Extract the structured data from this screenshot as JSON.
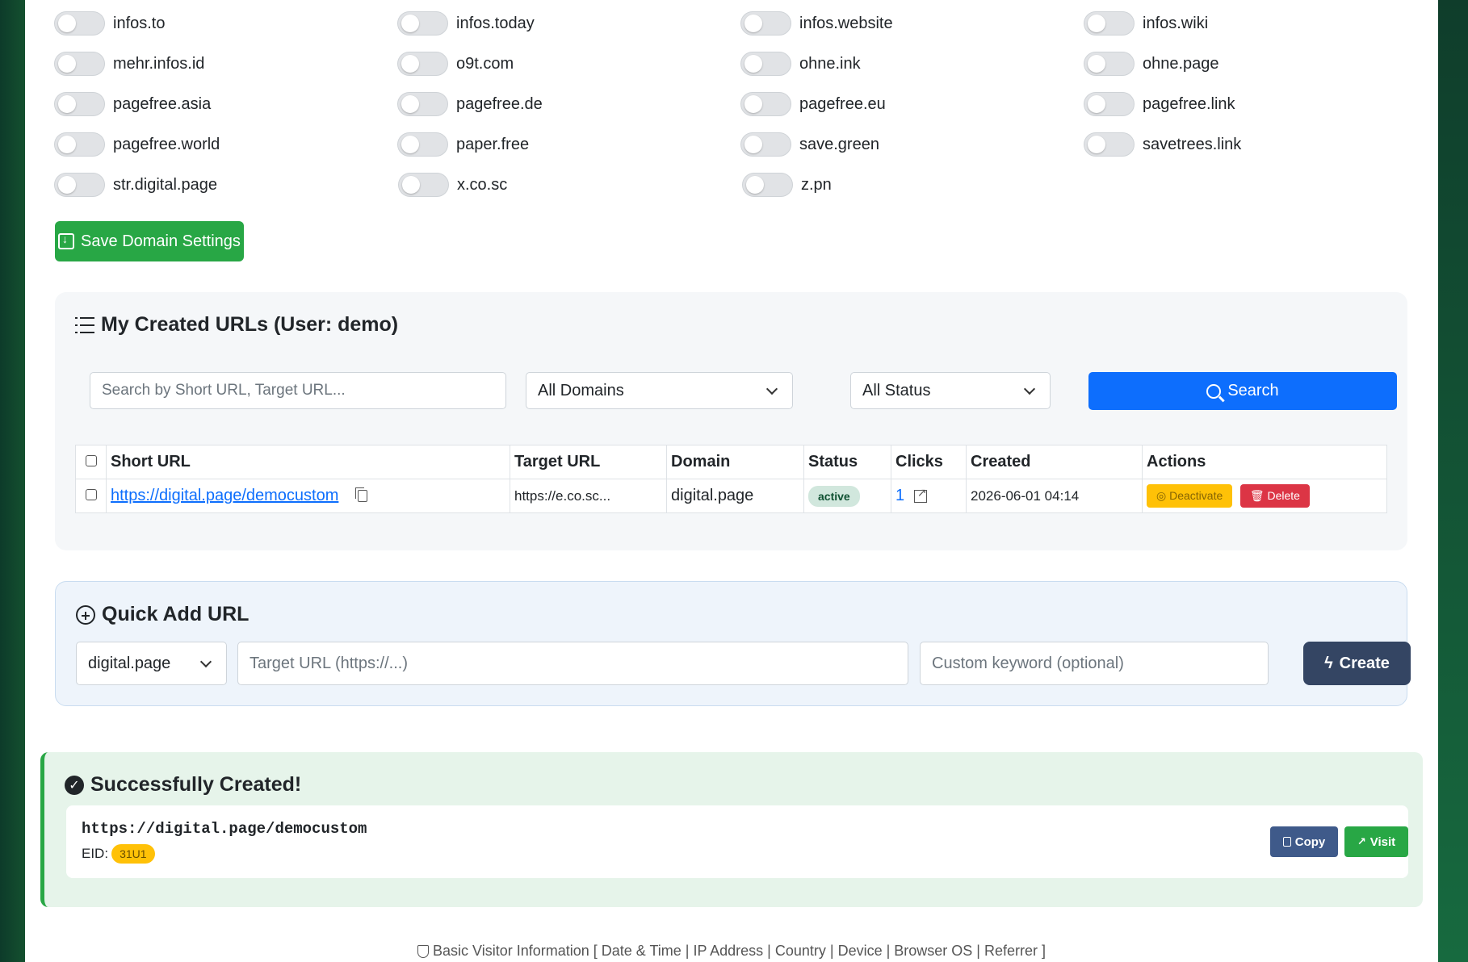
{
  "domains": [
    [
      "infos.to",
      "infos.today",
      "infos.website",
      "infos.wiki"
    ],
    [
      "mehr.infos.id",
      "o9t.com",
      "ohne.ink",
      "ohne.page"
    ],
    [
      "pagefree.asia",
      "pagefree.de",
      "pagefree.eu",
      "pagefree.link"
    ],
    [
      "pagefree.world",
      "paper.free",
      "save.green",
      "savetrees.link"
    ],
    [
      "str.digital.page",
      "x.co.sc",
      "z.pn",
      ""
    ]
  ],
  "save_label": "Save Domain Settings",
  "urls_card": {
    "title": "My Created URLs (User: demo)",
    "search_placeholder": "Search by Short URL, Target URL...",
    "domain_filter": "All Domains",
    "status_filter": "All Status",
    "search_label": "Search",
    "columns": [
      "Short URL",
      "Target URL",
      "Domain",
      "Status",
      "Clicks",
      "Created",
      "Actions"
    ],
    "rows": [
      {
        "short_url": "https://digital.page/democustom",
        "target_url": "https://e.co.sc...",
        "domain": "digital.page",
        "status": "active",
        "clicks": "1",
        "created": "2026-06-01 04:14",
        "deactivate": "Deactivate",
        "delete": "Delete"
      }
    ]
  },
  "quick_add": {
    "title": "Quick Add URL",
    "domain": "digital.page",
    "target_placeholder": "Target URL (https://...)",
    "keyword_placeholder": "Custom keyword (optional)",
    "create_label": "Create"
  },
  "success": {
    "title": "Successfully Created!",
    "url": "https://digital.page/democustom",
    "eid_label": "EID:",
    "eid": "31U1",
    "copy_label": "Copy",
    "visit_label": "Visit"
  },
  "footer": "Basic Visitor Information [ Date & Time | IP Address | Country | Device | Browser OS | Referrer ]",
  "colors": {
    "primary": "#0d6efd",
    "success": "#28a745",
    "warning": "#ffc107",
    "danger": "#dc3545",
    "dark": "#344563"
  }
}
